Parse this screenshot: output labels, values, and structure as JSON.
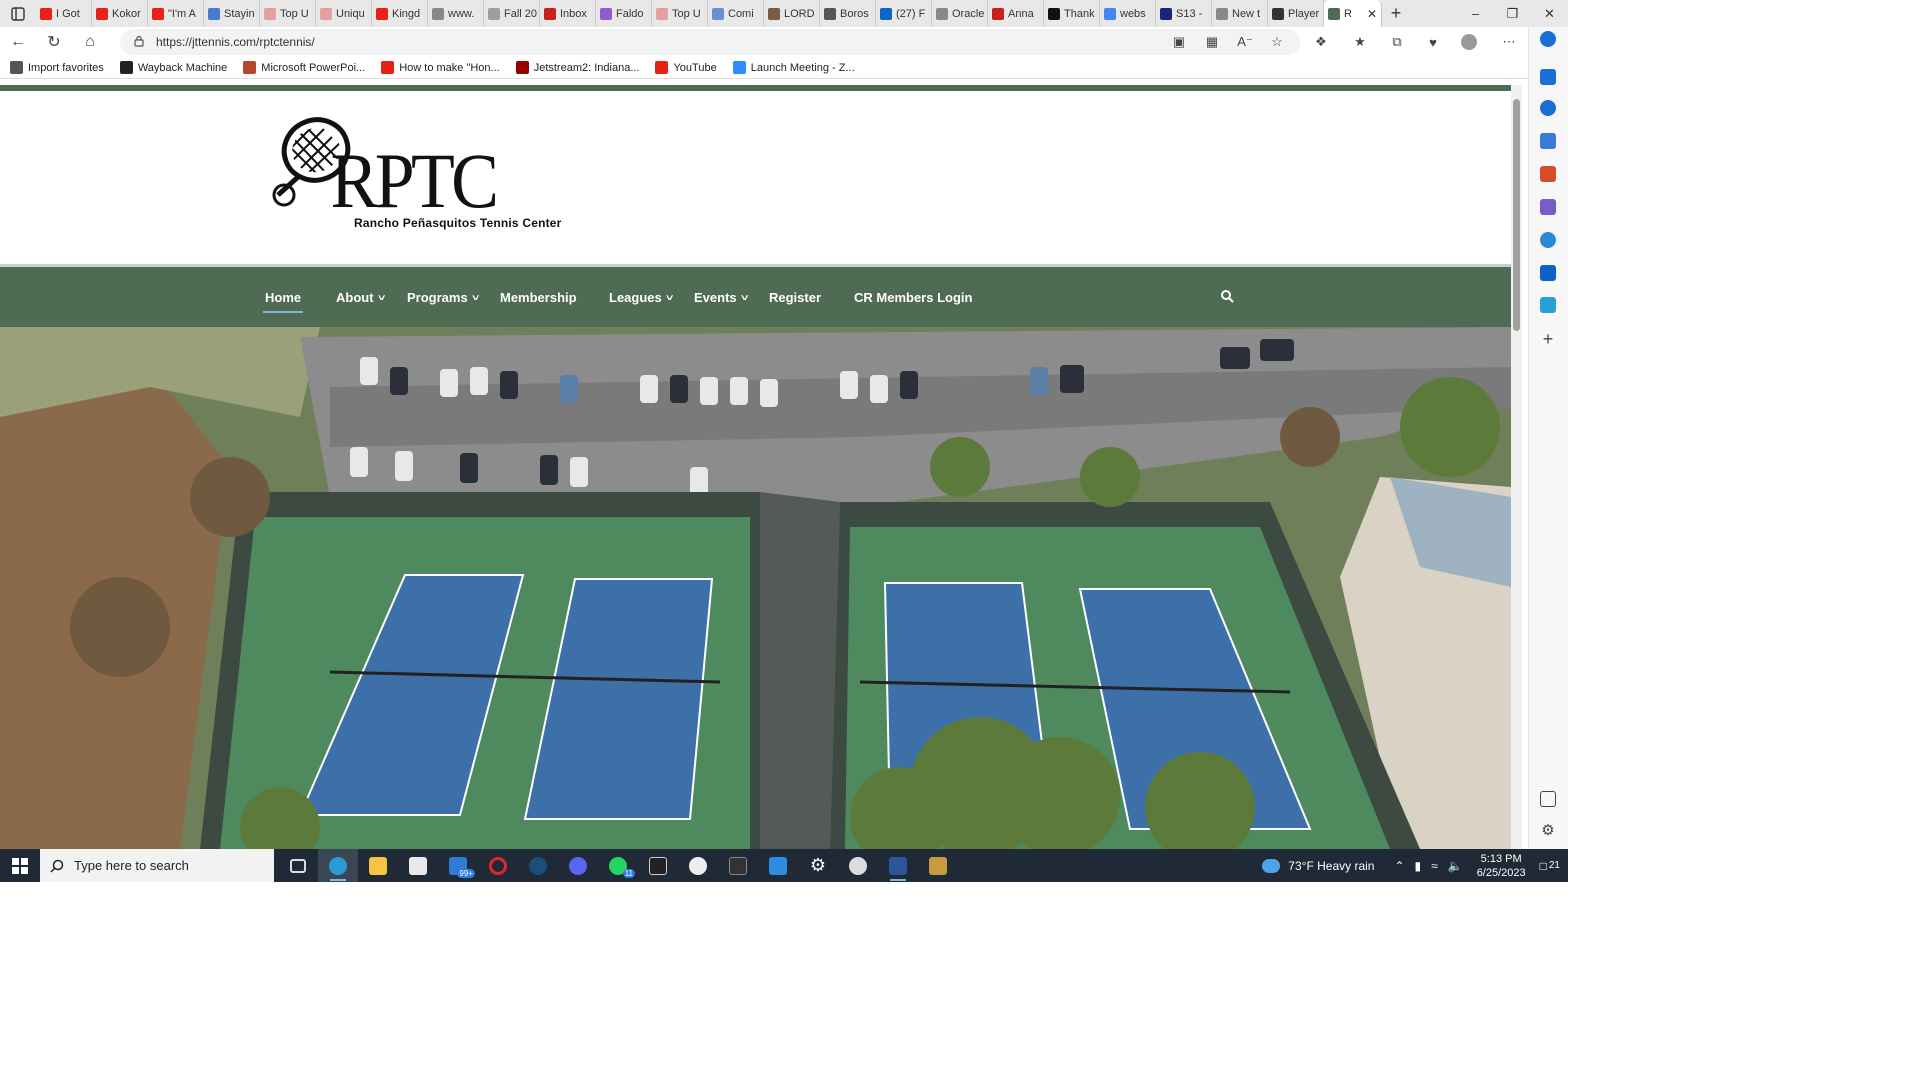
{
  "browser": {
    "tabs": [
      {
        "label": "I Got",
        "color": "#e62117"
      },
      {
        "label": "Kokor",
        "color": "#e62117"
      },
      {
        "label": "\"I'm A",
        "color": "#e62117"
      },
      {
        "label": "Stayin",
        "color": "#4a7bd1"
      },
      {
        "label": "Top U",
        "color": "#e3a0a0"
      },
      {
        "label": "Uniqu",
        "color": "#e3a0a0"
      },
      {
        "label": "Kingd",
        "color": "#e62117"
      },
      {
        "label": "www.",
        "color": "#888888"
      },
      {
        "label": "Fall 20",
        "color": "#9e9e9e"
      },
      {
        "label": "Inbox",
        "color": "#c5221f"
      },
      {
        "label": "Faldo",
        "color": "#8e5bd4"
      },
      {
        "label": "Top U",
        "color": "#e3a0a0"
      },
      {
        "label": "Comi",
        "color": "#6a8fd1"
      },
      {
        "label": "LORD",
        "color": "#7a5c45"
      },
      {
        "label": "Boros",
        "color": "#555555"
      },
      {
        "label": "(27) F",
        "color": "#0a66c2"
      },
      {
        "label": "Oracle",
        "color": "#888888"
      },
      {
        "label": "Anna",
        "color": "#c5221f"
      },
      {
        "label": "Thank",
        "color": "#111111"
      },
      {
        "label": "webs",
        "color": "#4285f4"
      },
      {
        "label": "S13 -",
        "color": "#1a237e"
      },
      {
        "label": "New t",
        "color": "#888888"
      },
      {
        "label": "Player",
        "color": "#333333"
      },
      {
        "label": "R",
        "color": "#4f6b53",
        "active": true
      }
    ],
    "url": "https://jttennis.com/rptctennis/",
    "favorites": [
      {
        "label": "Import favorites",
        "color": "#555555"
      },
      {
        "label": "Wayback Machine",
        "color": "#222222"
      },
      {
        "label": "Microsoft PowerPoi...",
        "color": "#b7472a"
      },
      {
        "label": "How to make \"Hon...",
        "color": "#e62117"
      },
      {
        "label": "Jetstream2: Indiana...",
        "color": "#990000"
      },
      {
        "label": "YouTube",
        "color": "#e62117"
      },
      {
        "label": "Launch Meeting - Z...",
        "color": "#2d8cff"
      }
    ]
  },
  "site": {
    "logo_text": "RPTC",
    "logo_subtitle": "Rancho Peñasquitos Tennis Center",
    "nav": [
      {
        "label": "Home",
        "dropdown": false,
        "active": true
      },
      {
        "label": "About",
        "dropdown": true
      },
      {
        "label": "Programs",
        "dropdown": true
      },
      {
        "label": "Membership",
        "dropdown": false
      },
      {
        "label": "Leagues",
        "dropdown": true
      },
      {
        "label": "Events",
        "dropdown": true
      },
      {
        "label": "Register",
        "dropdown": false
      },
      {
        "label": "CR Members Login",
        "dropdown": false
      }
    ],
    "accent": "#4f6b53"
  },
  "taskbar": {
    "search_placeholder": "Type here to search",
    "mail_badge": "99+",
    "whatsapp_badge": "11",
    "weather": "73°F  Heavy rain",
    "time": "5:13 PM",
    "date": "6/25/2023",
    "notifications": "21"
  }
}
